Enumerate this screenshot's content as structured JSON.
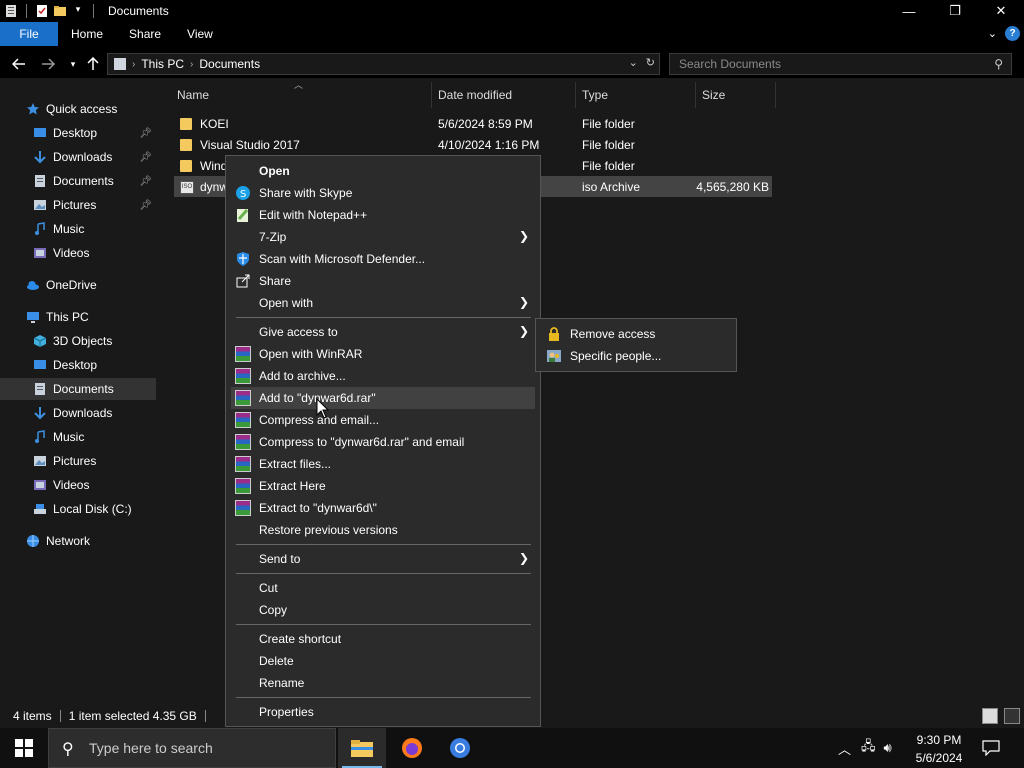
{
  "window": {
    "title": "Documents",
    "controls": {
      "minimize": "—",
      "maximize": "❐",
      "close": "✕"
    }
  },
  "ribbon": {
    "tabs": [
      "File",
      "Home",
      "Share",
      "View"
    ],
    "help": "?"
  },
  "address": {
    "crumbs": [
      "This PC",
      "Documents"
    ],
    "search_placeholder": "Search Documents"
  },
  "nav": {
    "items": [
      {
        "label": "Quick access",
        "icon": "star-icon",
        "pinned": false
      },
      {
        "label": "Desktop",
        "icon": "desktop-icon",
        "pinned": true
      },
      {
        "label": "Downloads",
        "icon": "download-icon",
        "pinned": true
      },
      {
        "label": "Documents",
        "icon": "document-icon",
        "pinned": true
      },
      {
        "label": "Pictures",
        "icon": "pictures-icon",
        "pinned": true
      },
      {
        "label": "Music",
        "icon": "music-icon",
        "pinned": false
      },
      {
        "label": "Videos",
        "icon": "videos-icon",
        "pinned": false
      },
      {
        "label": "OneDrive",
        "icon": "cloud-icon",
        "pinned": false
      },
      {
        "label": "This PC",
        "icon": "pc-icon",
        "pinned": false
      },
      {
        "label": "3D Objects",
        "icon": "3d-objects-icon",
        "pinned": false
      },
      {
        "label": "Desktop",
        "icon": "desktop-icon",
        "pinned": false
      },
      {
        "label": "Documents",
        "icon": "document-icon",
        "pinned": false,
        "selected": true
      },
      {
        "label": "Downloads",
        "icon": "download-icon",
        "pinned": false
      },
      {
        "label": "Music",
        "icon": "music-icon",
        "pinned": false
      },
      {
        "label": "Pictures",
        "icon": "pictures-icon",
        "pinned": false
      },
      {
        "label": "Videos",
        "icon": "videos-icon",
        "pinned": false
      },
      {
        "label": "Local Disk (C:)",
        "icon": "disk-icon",
        "pinned": false
      },
      {
        "label": "Network",
        "icon": "network-icon",
        "pinned": false
      }
    ]
  },
  "columns": {
    "name": "Name",
    "date": "Date modified",
    "type": "Type",
    "size": "Size"
  },
  "files": [
    {
      "name": "KOEI",
      "date": "5/6/2024 8:59 PM",
      "type": "File folder",
      "size": ""
    },
    {
      "name": "Visual Studio 2017",
      "date": "4/10/2024 1:16 PM",
      "type": "File folder",
      "size": ""
    },
    {
      "name": "Windo",
      "date": "",
      "type": "File folder",
      "size": ""
    },
    {
      "name": "dynw",
      "date": "",
      "type": "iso Archive",
      "size": "4,565,280 KB"
    }
  ],
  "status": {
    "item_count": "4 items",
    "selection": "1 item selected  4.35 GB"
  },
  "context_menu": {
    "open": "Open",
    "share_skype": "Share with Skype",
    "edit_notepad": "Edit with Notepad++",
    "zip": "7-Zip",
    "defender": "Scan with Microsoft Defender...",
    "share": "Share",
    "open_with": "Open with",
    "give_access": "Give access to",
    "open_winrar": "Open with WinRAR",
    "add_archive": "Add to archive...",
    "add_rar": "Add to \"dynwar6d.rar\"",
    "compress_email": "Compress and email...",
    "compress_rar_email": "Compress to \"dynwar6d.rar\" and email",
    "extract_files": "Extract files...",
    "extract_here": "Extract Here",
    "extract_to": "Extract to \"dynwar6d\\\"",
    "restore": "Restore previous versions",
    "send_to": "Send to",
    "cut": "Cut",
    "copy": "Copy",
    "create_shortcut": "Create shortcut",
    "delete": "Delete",
    "rename": "Rename",
    "properties": "Properties"
  },
  "submenu": {
    "remove_access": "Remove access",
    "specific_people": "Specific people..."
  },
  "taskbar": {
    "search_placeholder": "Type here to search",
    "time": "9:30 PM",
    "date": "5/6/2024"
  },
  "colors": {
    "accent": "#1a70c9",
    "background": "#191919",
    "menu": "#2b2b2b",
    "folder": "#f4c95d"
  }
}
